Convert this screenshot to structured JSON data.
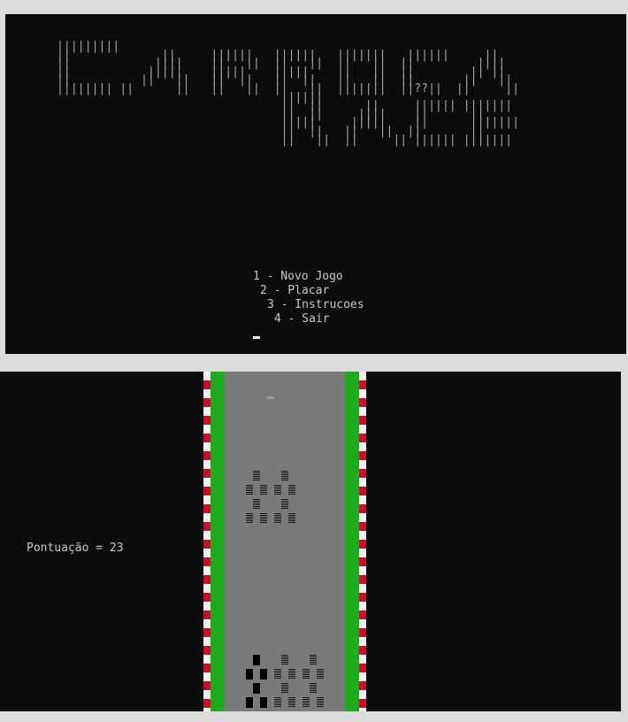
{
  "menu_screen": {
    "logo_ascii": "|||||||||\n||             ||     ||||||   ||||||   |||||||   ||||||     ||\n||            ||||    ||   ||  ||   ||  ||   ||  ||         ||||\n||           |||||    |||||    |||||    ||   ||  ||        || ||\n||          ||   ||   ||  ||   ||  ||   ||   ||  ||       ||   ||\n|||||||| ||      ||   ||   ||  ||   ||  |||||||  ||??||  ||     ||\n                                ||||||\n                                ||  ||      ||     |||||| |||||||\n                                ||  ||     ||||    ||      ||\n                                |||||     |||||    ||      |||||||\n                                ||  ||   ||   ||  ||       ||\n                                ||   ||  ||     || |||||| |||||||",
    "options": [
      "1 - Novo Jogo",
      "2 - Placar",
      "3 - Instrucoes",
      "4 - Sair"
    ]
  },
  "game_screen": {
    "score_text": "Pontuação = 23"
  },
  "colors": {
    "console_bg": "#0c0c0c",
    "text": "#c8c8c8",
    "road": "#7a7a7a",
    "grass": "#1faa1f",
    "curb_red": "#c8102e",
    "curb_white": "#f2f2f2"
  }
}
